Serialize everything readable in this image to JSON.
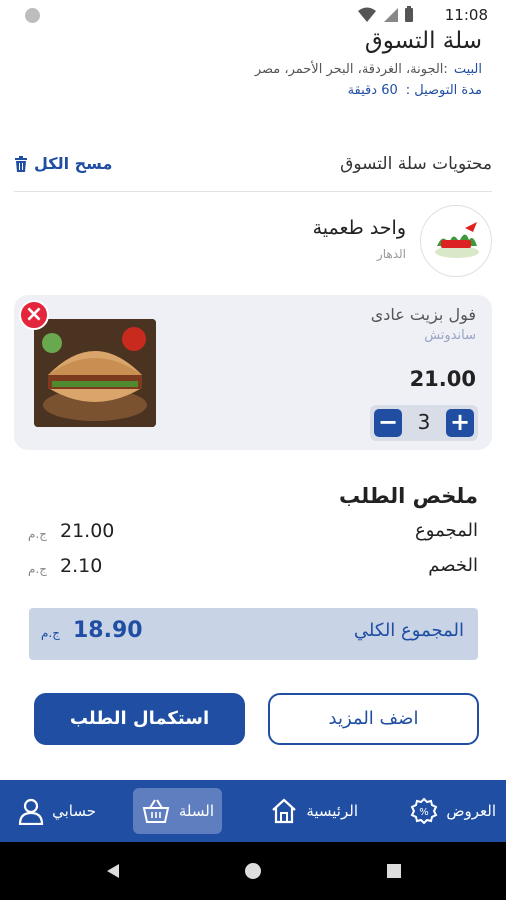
{
  "status_bar": {
    "time": "11:08"
  },
  "header": {
    "title": "سلة التسوق",
    "address_label": "البيت",
    "address": ":الجونة، الغردقة، البحر الأحمر، مصر",
    "eta_label": "مدة التوصيل :",
    "eta_value": "60 دقيقة"
  },
  "cart": {
    "section_title": "محتويات سلة التسوق",
    "clear_all": "مسح الكل",
    "store": {
      "name": "واحد طعمية",
      "area": "الدهار"
    },
    "items": [
      {
        "name": "فول بزيت عادى",
        "category": "ساندوتش",
        "price": "21.00",
        "quantity": "3"
      }
    ]
  },
  "summary": {
    "title": "ملخص الطلب",
    "subtotal_label": "المجموع",
    "subtotal_value": "21.00",
    "discount_label": "الخصم",
    "discount_value": "2.10",
    "currency": "ج.م",
    "total_label": "المجموع الكلي",
    "total_value": "18.90"
  },
  "actions": {
    "add_more": "اضف المزيد",
    "complete_order": "استكمال الطلب"
  },
  "bottom_nav": {
    "offers": "العروض",
    "home": "الرئيسية",
    "cart": "السلة",
    "account": "حسابي"
  },
  "colors": {
    "primary": "#1f4ea3",
    "danger": "#e3263b",
    "card_bg": "#eef0f5",
    "total_bg": "#c8d3e6"
  }
}
